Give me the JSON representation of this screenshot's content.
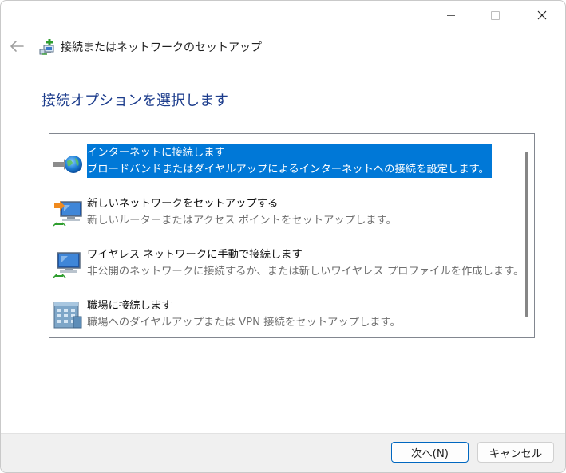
{
  "window": {
    "title": "接続またはネットワークのセットアップ"
  },
  "page": {
    "heading": "接続オプションを選択します"
  },
  "options": [
    {
      "title": "インターネットに接続します",
      "description": "ブロードバンドまたはダイヤルアップによるインターネットへの接続を設定します。",
      "icon": "globe-connection-icon",
      "selected": true
    },
    {
      "title": "新しいネットワークをセットアップする",
      "description": "新しいルーターまたはアクセス ポイントをセットアップします。",
      "icon": "new-network-icon",
      "selected": false
    },
    {
      "title": "ワイヤレス ネットワークに手動で接続します",
      "description": "非公開のネットワークに接続するか、または新しいワイヤレス プロファイルを作成します。",
      "icon": "wireless-network-icon",
      "selected": false
    },
    {
      "title": "職場に接続します",
      "description": "職場へのダイヤルアップまたは VPN 接続をセットアップします。",
      "icon": "workplace-icon",
      "selected": false
    }
  ],
  "buttons": {
    "next": "次へ(N)",
    "cancel": "キャンセル"
  },
  "colors": {
    "heading": "#1c3c8c",
    "selection": "#0078d7",
    "default_button_border": "#0067c0"
  }
}
